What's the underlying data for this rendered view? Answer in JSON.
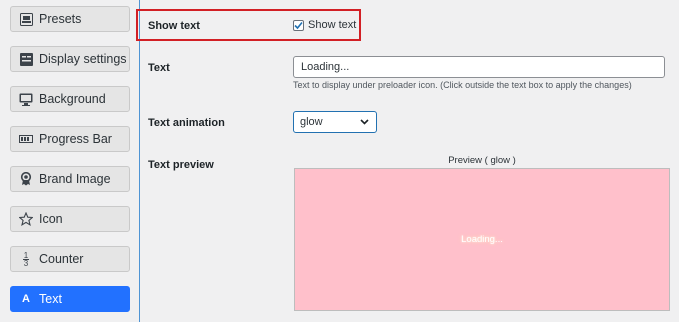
{
  "sidebar": {
    "items": [
      {
        "label": "Presets",
        "icon": "presets-icon"
      },
      {
        "label": "Display settings",
        "icon": "display-settings-icon"
      },
      {
        "label": "Background",
        "icon": "monitor-icon"
      },
      {
        "label": "Progress Bar",
        "icon": "progress-bar-icon"
      },
      {
        "label": "Brand Image",
        "icon": "badge-icon"
      },
      {
        "label": "Icon",
        "icon": "star-icon"
      },
      {
        "label": "Counter",
        "icon": "fraction-icon"
      },
      {
        "label": "Text",
        "icon": "text-a-icon",
        "active": true
      }
    ]
  },
  "show_text": {
    "label": "Show text",
    "checkbox_label": "Show text",
    "checked": true
  },
  "text_field": {
    "label": "Text",
    "value": "Loading...",
    "hint": "Text to display under preloader icon. (Click outside the text box to apply the changes)"
  },
  "animation": {
    "label": "Text animation",
    "selected": "glow"
  },
  "preview": {
    "label": "Text preview",
    "title_prefix": "Preview ( ",
    "title_value": "glow",
    "title_suffix": " )",
    "text": "Loading...",
    "background": "#ffc0cb"
  },
  "colors": {
    "accent": "#2271ff",
    "highlight_border": "#d21f25"
  }
}
